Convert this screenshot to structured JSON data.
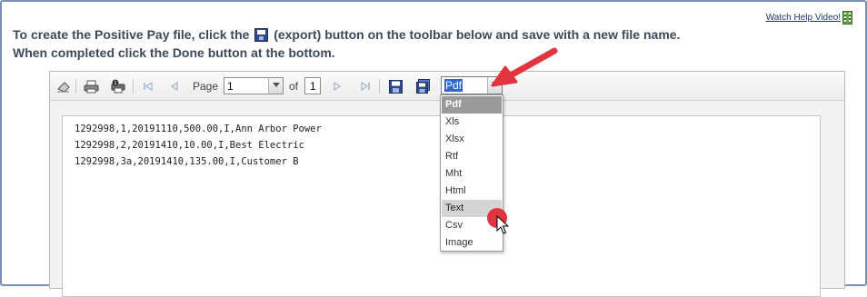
{
  "help": {
    "link_text": "Watch Help Video!",
    "icon": "film-icon"
  },
  "instructions": {
    "line1_before": "To create the Positive Pay file, click the",
    "line1_after": "(export) button on the toolbar below and save with a new file name.",
    "line2": "When completed click the Done button at the bottom."
  },
  "toolbar": {
    "page_label": "Page",
    "page_value": "1",
    "of_label": "of",
    "total_pages": "1",
    "format_value": "Pdf",
    "icons": [
      "eraser-icon",
      "print-icon",
      "print-preview-icon",
      "first-page-icon",
      "prev-page-icon",
      "next-page-icon",
      "last-page-icon",
      "save-icon",
      "export-icon"
    ]
  },
  "format_dropdown": {
    "options": [
      "Pdf",
      "Xls",
      "Xlsx",
      "Rtf",
      "Mht",
      "Html",
      "Text",
      "Csv",
      "Image"
    ],
    "selected": "Pdf",
    "hovered": "Text"
  },
  "document": {
    "lines": [
      "1292998,1,20191110,500.00,I,Ann Arbor Power",
      "1292998,2,20191410,10.00,I,Best Electric",
      "1292998,3a,20191410,135.00,I,Customer B"
    ]
  },
  "colors": {
    "annotation_red": "#e2343f",
    "instruction_text": "#3d4a5c",
    "highlight_blue": "#3366cc"
  }
}
